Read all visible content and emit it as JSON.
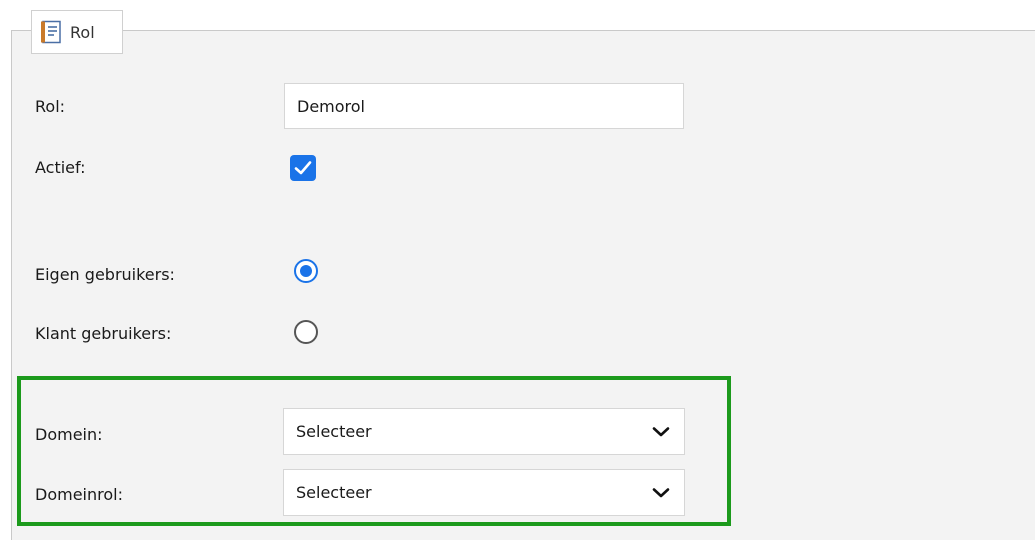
{
  "legend": {
    "title": "Rol",
    "icon": "document-list-icon"
  },
  "fields": {
    "rol": {
      "label": "Rol:",
      "value": "Demorol",
      "placeholder": ""
    },
    "actief": {
      "label": "Actief:",
      "checked": true
    },
    "eigen_gebruikers": {
      "label": "Eigen gebruikers:",
      "selected": true
    },
    "klant_gebruikers": {
      "label": "Klant gebruikers:",
      "selected": false
    },
    "domein": {
      "label": "Domein:",
      "value": "Selecteer"
    },
    "domeinrol": {
      "label": "Domeinrol:",
      "value": "Selecteer"
    }
  },
  "colors": {
    "accent": "#1a73e8",
    "highlight": "#1c9a1c",
    "panel": "#f3f3f3"
  }
}
